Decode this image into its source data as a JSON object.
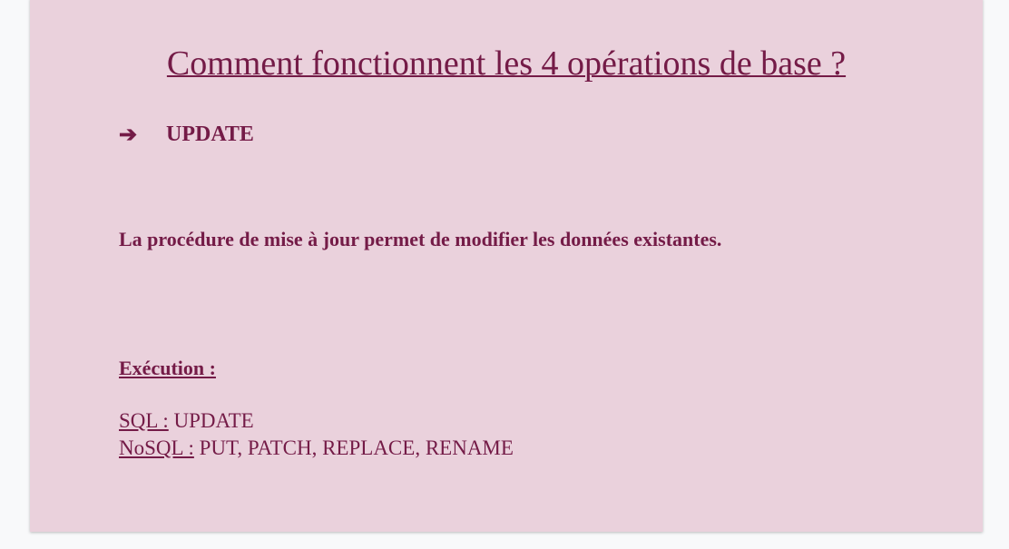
{
  "title": "Comment fonctionnent les 4 opérations de base ?",
  "bullet": {
    "icon": "arrow-right-icon",
    "symbol": "➔",
    "label": "UPDATE"
  },
  "paragraph": "La procédure de mise à jour permet de modifier les données existantes.",
  "execution_label": "Exécution :",
  "lines": [
    {
      "label": "SQL :",
      "value": " UPDATE"
    },
    {
      "label": "NoSQL :",
      "value": " PUT, PATCH, REPLACE, RENAME"
    }
  ],
  "colors": {
    "background": "#ead1dc",
    "text": "#741b47",
    "page": "#f8f9fa"
  }
}
